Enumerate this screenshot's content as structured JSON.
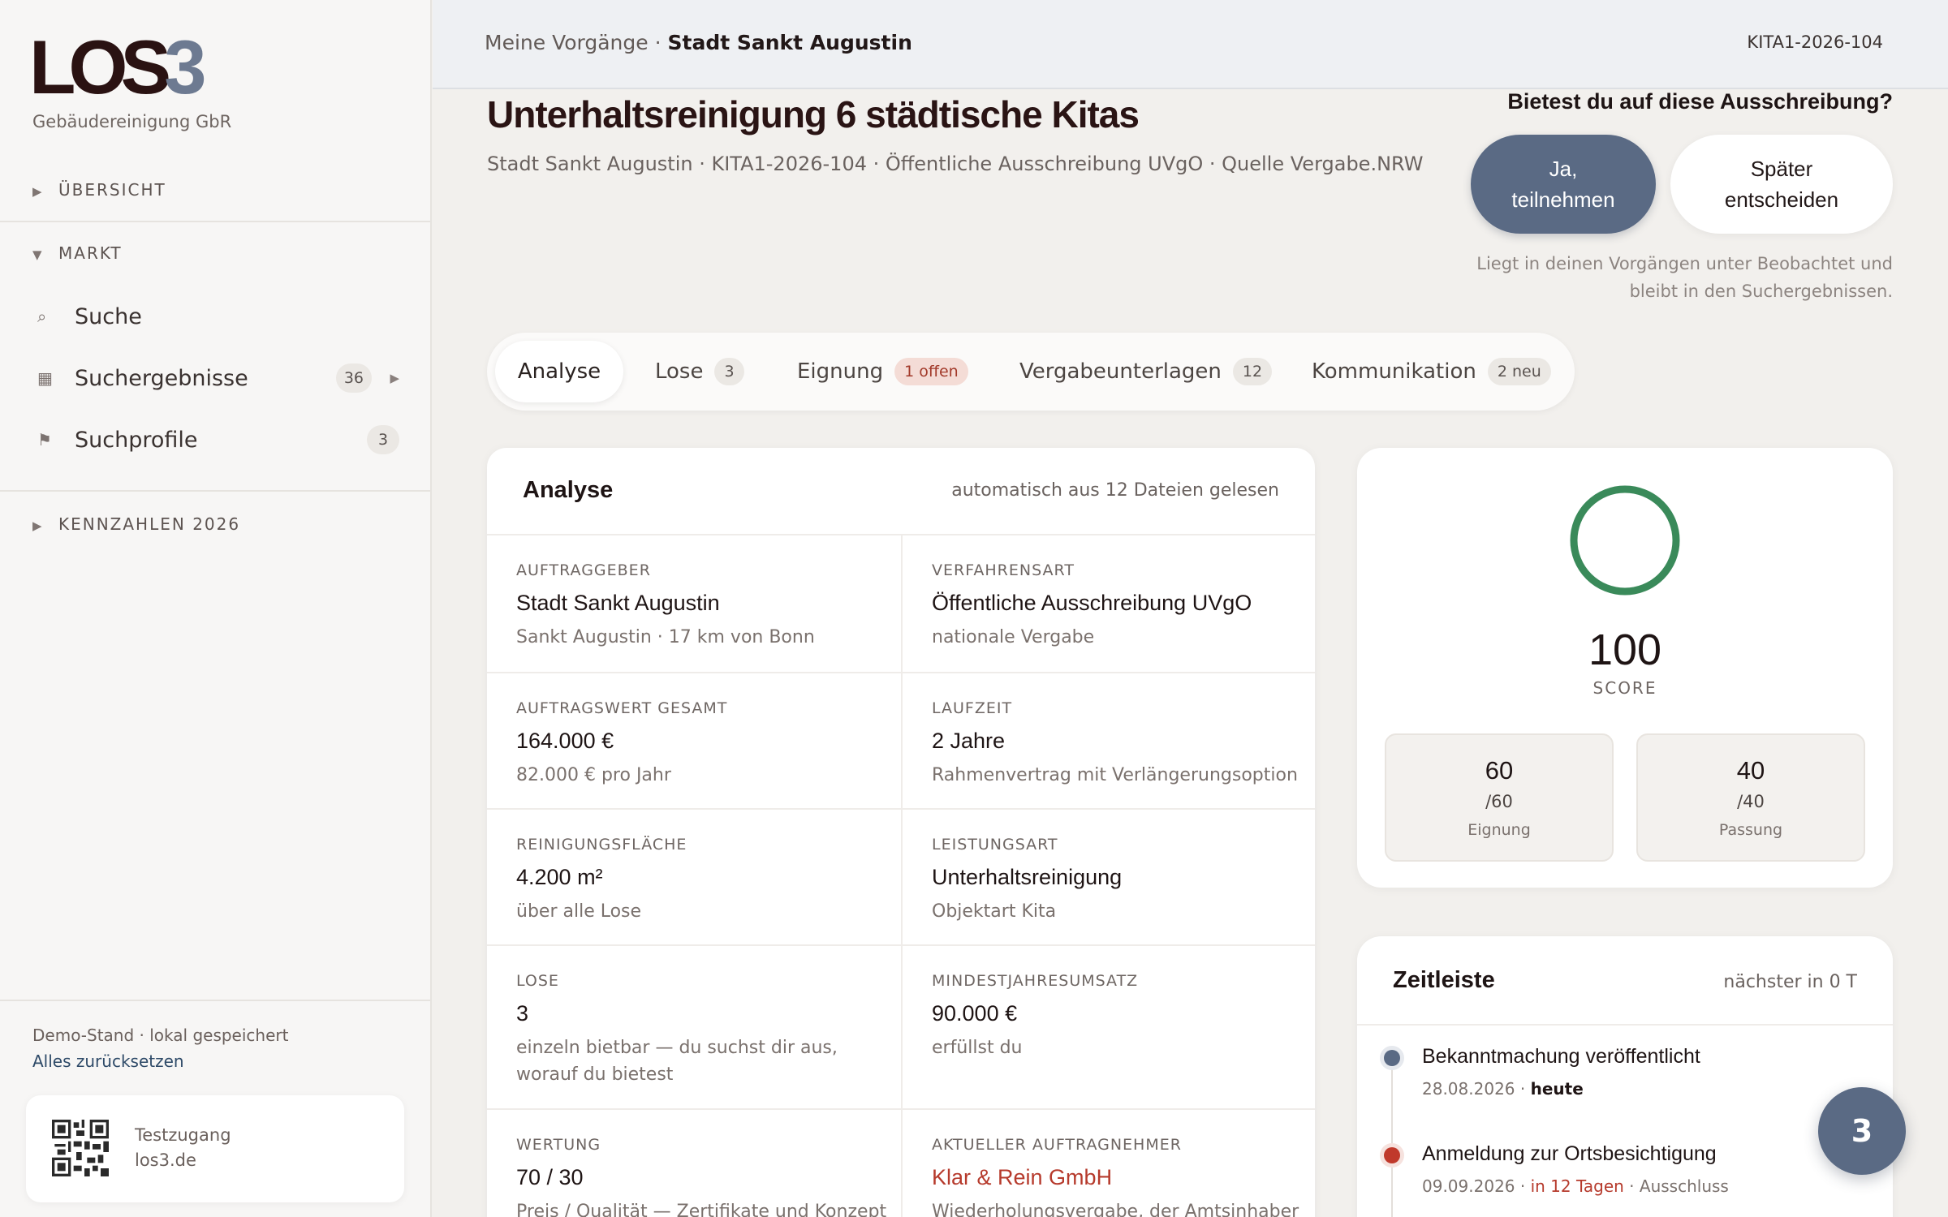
{
  "brand": {
    "logo_main": "LOS",
    "logo_num": "3",
    "subtitle": "Gebäudereinigung GbR"
  },
  "sidebar": {
    "sections": [
      {
        "label": "ÜBERSICHT",
        "expanded": false
      },
      {
        "label": "MARKT",
        "expanded": true
      },
      {
        "label": "KENNZAHLEN 2026",
        "expanded": false
      }
    ],
    "items": [
      {
        "icon": "search-icon",
        "label": "Suche",
        "count": ""
      },
      {
        "icon": "grid-icon",
        "label": "Suchergebnisse",
        "count": "36"
      },
      {
        "icon": "flag-icon",
        "label": "Suchprofile",
        "count": "3"
      }
    ],
    "footer": {
      "status": "Demo-Stand · lokal gespeichert",
      "reset": "Alles zurücksetzen"
    },
    "qr": {
      "line1": "Testzugang",
      "line2": "los3.de"
    }
  },
  "topbar": {
    "crumb_parent": "Meine Vorgänge",
    "crumb_sep": " · ",
    "crumb_current": "Stadt Sankt Augustin",
    "id": "KITA1-2026-104"
  },
  "header": {
    "title": "Unterhaltsreinigung 6 städtische Kitas",
    "subtitle": "Stadt Sankt Augustin · KITA1-2026-104 · Öffentliche Ausschreibung UVgO · Quelle Vergabe.NRW"
  },
  "decision": {
    "question": "Bietest du auf diese Ausschreibung?",
    "yes_line1": "Ja,",
    "yes_line2": "teilnehmen",
    "later_line1": "Später",
    "later_line2": "entscheiden",
    "hint_line1": "Liegt in deinen Vorgängen unter Beobachtet und",
    "hint_line2": "bleibt in den Suchergebnissen."
  },
  "tabs": [
    {
      "label": "Analyse",
      "badge": "",
      "active": true
    },
    {
      "label": "Lose",
      "badge": "3"
    },
    {
      "label": "Eignung",
      "badge": "1 offen",
      "warn": true
    },
    {
      "label": "Vergabeunterlagen",
      "badge": "12"
    },
    {
      "label": "Kommunikation",
      "badge": "2 neu"
    }
  ],
  "analysis": {
    "title": "Analyse",
    "note": "automatisch aus 12 Dateien gelesen",
    "fields": [
      {
        "key": "AUFTRAGGEBER",
        "value": "Stadt Sankt Augustin",
        "sub": "Sankt Augustin · 17 km von Bonn"
      },
      {
        "key": "VERFAHRENSART",
        "value": "Öffentliche Ausschreibung UVgO",
        "sub": "nationale Vergabe"
      },
      {
        "key": "AUFTRAGSWERT GESAMT",
        "value": "164.000 €",
        "sub": "82.000 € pro Jahr"
      },
      {
        "key": "LAUFZEIT",
        "value": "2 Jahre",
        "sub": "Rahmenvertrag mit Verlängerungsoption"
      },
      {
        "key": "REINIGUNGSFLÄCHE",
        "value": "4.200 m²",
        "sub": "über alle Lose"
      },
      {
        "key": "LEISTUNGSART",
        "value": "Unterhaltsreinigung",
        "sub": "Objektart Kita"
      },
      {
        "key": "LOSE",
        "value": "3",
        "sub_line1": "einzeln bietbar — du suchst dir aus,",
        "sub_line2": "worauf du bietest"
      },
      {
        "key": "MINDESTJAHRESUMSATZ",
        "value": "90.000 €",
        "sub": "erfüllst du"
      },
      {
        "key": "WERTUNG",
        "value": "70 / 30",
        "sub": "Preis / Qualität — Zertifikate und Konzept"
      },
      {
        "key": "AKTUELLER AUFTRAGNEHMER",
        "value": "Klar & Rein GmbH",
        "sub": "Wiederholungsvergabe, der Amtsinhaber"
      }
    ]
  },
  "score": {
    "value": "100",
    "label": "SCORE",
    "ring_color": "#3a8a5a",
    "ring_fraction": 1.0,
    "parts": [
      {
        "num": "60",
        "den": "/60",
        "label": "Eignung"
      },
      {
        "num": "40",
        "den": "/40",
        "label": "Passung"
      }
    ]
  },
  "timeline": {
    "title": "Zeitleiste",
    "note": "nächster in 0 T",
    "events": [
      {
        "title": "Bekanntmachung veröffentlicht",
        "date": "28.08.2026",
        "sep": " · ",
        "rel": "heute",
        "extra": "",
        "color": "#5a6a84"
      },
      {
        "title": "Anmeldung zur Ortsbesichtigung",
        "date": "09.09.2026",
        "sep": " · ",
        "rel": "in 12 Tagen",
        "extra": " · Ausschluss",
        "color": "#c0392b"
      }
    ]
  },
  "fab": {
    "count": "3"
  },
  "colors": {
    "accent": "#5a6a84",
    "danger": "#b63a2c",
    "success": "#3a8a5a"
  }
}
